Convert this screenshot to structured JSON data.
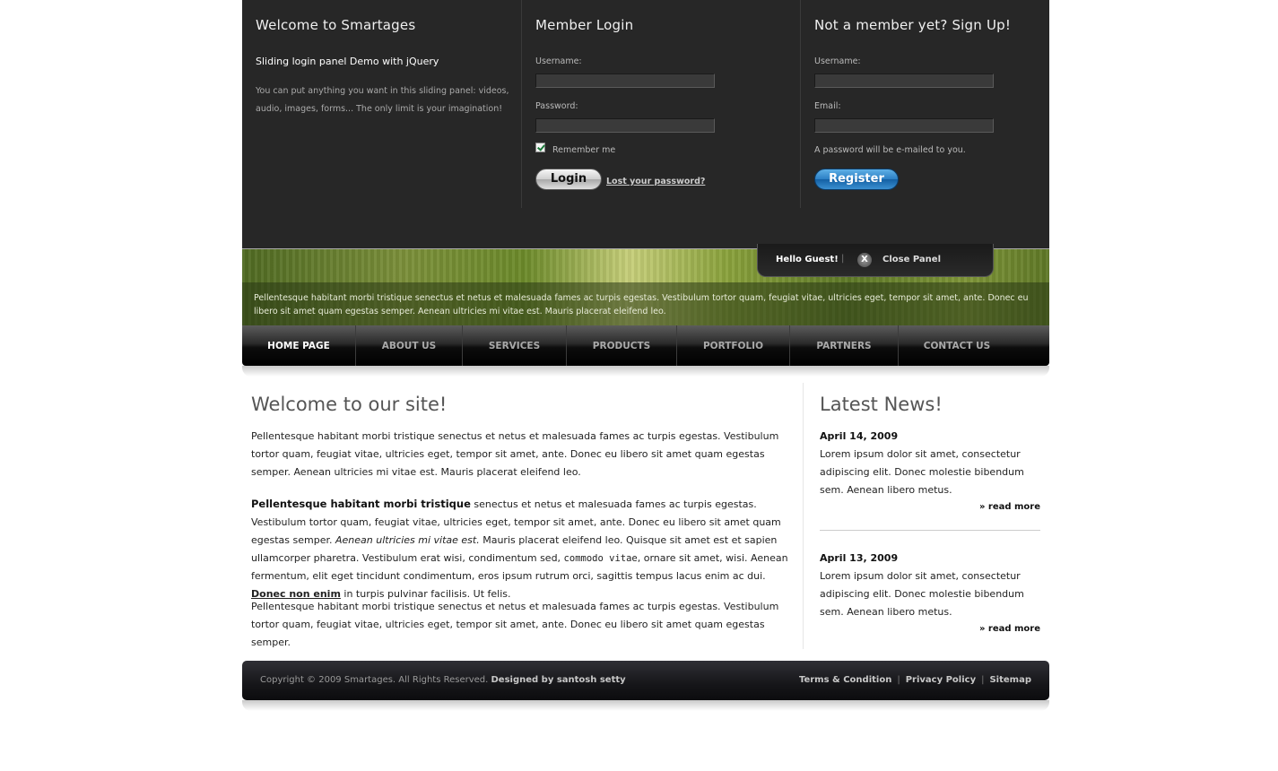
{
  "panel": {
    "welcome": {
      "title": "Welcome to Smartages",
      "subtitle": "Sliding login panel Demo with jQuery",
      "text": "You can put anything you want in this sliding panel: videos, audio, images, forms... The only limit is your imagination!"
    },
    "login": {
      "title": "Member Login",
      "username_label": "Username:",
      "password_label": "Password:",
      "username_value": "",
      "password_value": "",
      "remember_label": "Remember me",
      "remember_checked": true,
      "login_button": "Login",
      "lost_password": "Lost your password?"
    },
    "signup": {
      "title": "Not a member yet? Sign Up!",
      "username_label": "Username:",
      "email_label": "Email:",
      "username_value": "",
      "email_value": "",
      "note": "A password will be e-mailed to you.",
      "register_button": "Register"
    }
  },
  "tab": {
    "hello": "Hello Guest!",
    "separator": "|",
    "close_glyph": "X",
    "close_label": "Close Panel"
  },
  "banner": {
    "text": "Pellentesque habitant morbi tristique senectus et netus et malesuada fames ac turpis egestas. Vestibulum tortor quam, feugiat vitae, ultricies eget, tempor sit amet, ante. Donec eu libero sit amet quam egestas semper. Aenean ultricies mi vitae est. Mauris placerat eleifend leo."
  },
  "nav": {
    "items": [
      "HOME PAGE",
      "ABOUT US",
      "SERVICES",
      "PRODUCTS",
      "PORTFOLIO",
      "PARTNERS",
      "CONTACT US"
    ],
    "active": 0
  },
  "main": {
    "title": "Welcome to our site!",
    "p1": "Pellentesque habitant morbi tristique senectus et netus et malesuada fames ac turpis egestas. Vestibulum tortor quam, feugiat vitae, ultricies eget, tempor sit amet, ante. Donec eu libero sit amet quam egestas semper. Aenean ultricies mi vitae est. Mauris placerat eleifend leo.",
    "p2": {
      "bold": "Pellentesque habitant morbi tristique",
      "t1": " senectus et netus et malesuada fames ac turpis egestas. Vestibulum tortor quam, feugiat vitae, ultricies eget, tempor sit amet, ante. Donec eu libero sit amet quam egestas semper. ",
      "italic": "Aenean ultricies mi vitae est.",
      "t2": " Mauris placerat eleifend leo. Quisque sit amet est et sapien ullamcorper pharetra. Vestibulum erat wisi, condimentum sed, ",
      "code": "commodo vitae",
      "t3": ", ornare sit amet, wisi. Aenean fermentum, elit eget tincidunt condimentum, eros ipsum rutrum orci, sagittis tempus lacus enim ac dui. ",
      "link": "Donec non enim",
      "t4": " in turpis pulvinar facilisis. Ut felis."
    },
    "p3": "Pellentesque habitant morbi tristique senectus et netus et malesuada fames ac turpis egestas. Vestibulum tortor quam, feugiat vitae, ultricies eget, tempor sit amet, ante. Donec eu libero sit amet quam egestas semper."
  },
  "news": {
    "title": "Latest News!",
    "items": [
      {
        "date": "April 14, 2009",
        "text": "Lorem ipsum dolor sit amet, consectetur adipiscing elit. Donec molestie bibendum sem. Aenean libero metus.",
        "more": "» read more"
      },
      {
        "date": "April 13, 2009",
        "text": "Lorem ipsum dolor sit amet, consectetur adipiscing elit. Donec molestie bibendum sem. Aenean libero metus.",
        "more": "» read more"
      }
    ]
  },
  "footer": {
    "copyright": "Copyright © 2009 Smartages. All Rights Reserved. ",
    "designed": "Designed by santosh setty",
    "links": [
      "Terms & Condition",
      "Privacy Policy",
      "Sitemap"
    ],
    "separator": "|"
  }
}
